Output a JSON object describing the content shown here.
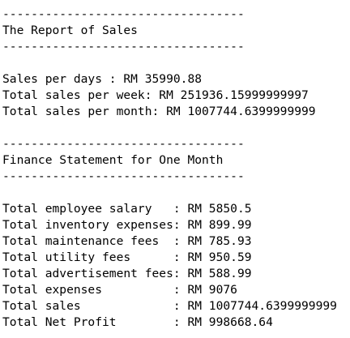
{
  "report": {
    "divider_top": "----------------------------------",
    "title": "The Report of Sales",
    "divider_bottom": "----------------------------------",
    "lines": [
      "Sales per days : RM 35990.88",
      "Total sales per week: RM 251936.15999999997",
      "Total sales per month: RM 1007744.6399999999"
    ]
  },
  "finance": {
    "divider_top": "----------------------------------",
    "title": "Finance Statement for One Month",
    "divider_bottom": "----------------------------------",
    "rows": [
      "Total employee salary   : RM 5850.5",
      "Total inventory expenses: RM 899.99",
      "Total maintenance fees  : RM 785.93",
      "Total utility fees      : RM 950.59",
      "Total advertisement fees: RM 588.99",
      "Total expenses          : RM 9076",
      "Total sales             : RM 1007744.6399999999",
      "Total Net Profit        : RM 998668.64"
    ]
  }
}
